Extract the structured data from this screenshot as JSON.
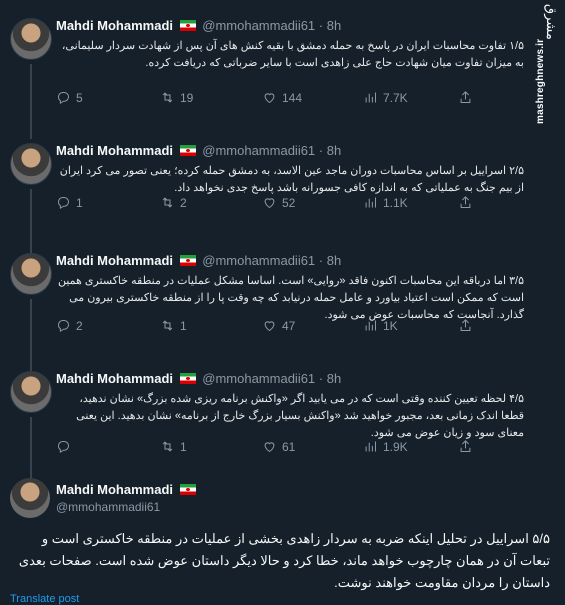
{
  "author": {
    "name": "Mahdi Mohammadi",
    "handle": "@mmohammadii61"
  },
  "tweets": [
    {
      "time": "8h",
      "text": "۱/۵ تفاوت محاسبات ایران در پاسخ به حمله دمشق با بقیه کنش های آن پس از شهادت سردار سلیمانی، به میزان تفاوت میان شهادت حاج علی زاهدی است با سایر ضرباتی که دریافت کرده.",
      "replies": "5",
      "retweets": "19",
      "likes": "144",
      "views": "7.7K"
    },
    {
      "time": "8h",
      "text": "۲/۵ اسراییل بر اساس محاسبات دوران ماجد عین الاسد، به دمشق حمله کرده؛ یعنی تصور می کرد ایران از بیم جنگ به عملیاتی که به اندازه کافی جسورانه باشد پاسخ جدی نخواهد داد.",
      "replies": "1",
      "retweets": "2",
      "likes": "52",
      "views": "1.1K"
    },
    {
      "time": "8h",
      "text": "۳/۵ اما درباقه این محاسبات اکنون فاقد «روایی» است. اساسا مشکل عملیات در منطقه خاکستری همین است که ممکن است اعتیاد بیاورد و عامل حمله درنیابد که چه وقت پا را از منطقه خاکستری بیرون می گذارد. آنجاست که محاسبات عوض می شود.",
      "replies": "2",
      "retweets": "1",
      "likes": "47",
      "views": "1K"
    },
    {
      "time": "8h",
      "text": "۴/۵ لحظه تعیین کننده وقتی است که در می یابید اگر «واکنش برنامه ریزی شده بزرگ» نشان ندهید، قطعا اندک زمانی بعد، مجبور خواهید شد «واکنش بسیار بزرگ خارج از برنامه» نشان بدهید. این یعنی معنای سود و زیان عوض می شود.",
      "replies": "",
      "retweets": "1",
      "likes": "61",
      "views": "1.9K"
    }
  ],
  "main_tweet": {
    "text": "۵/۵ اسراییل در تحلیل اینکه ضربه به سردار زاهدی بخشی از عملیات در منطقه خاکستری است و تبعات آن در همان چارچوب خواهد ماند، خطا کرد و حالا دیگر داستان عوض شده است. صفحات بعدی داستان را مردان مقاومت خواهند نوشت."
  },
  "translate_label": "Translate post",
  "watermark": {
    "logo": "مشرق",
    "site": "mashreghnews.ir"
  },
  "icons": [
    "reply-icon",
    "retweet-icon",
    "like-icon",
    "views-icon",
    "share-icon",
    "iran-flag-icon"
  ],
  "colors": {
    "background": "#15202b",
    "link": "#1d9bf0",
    "muted": "#8b98a5"
  }
}
